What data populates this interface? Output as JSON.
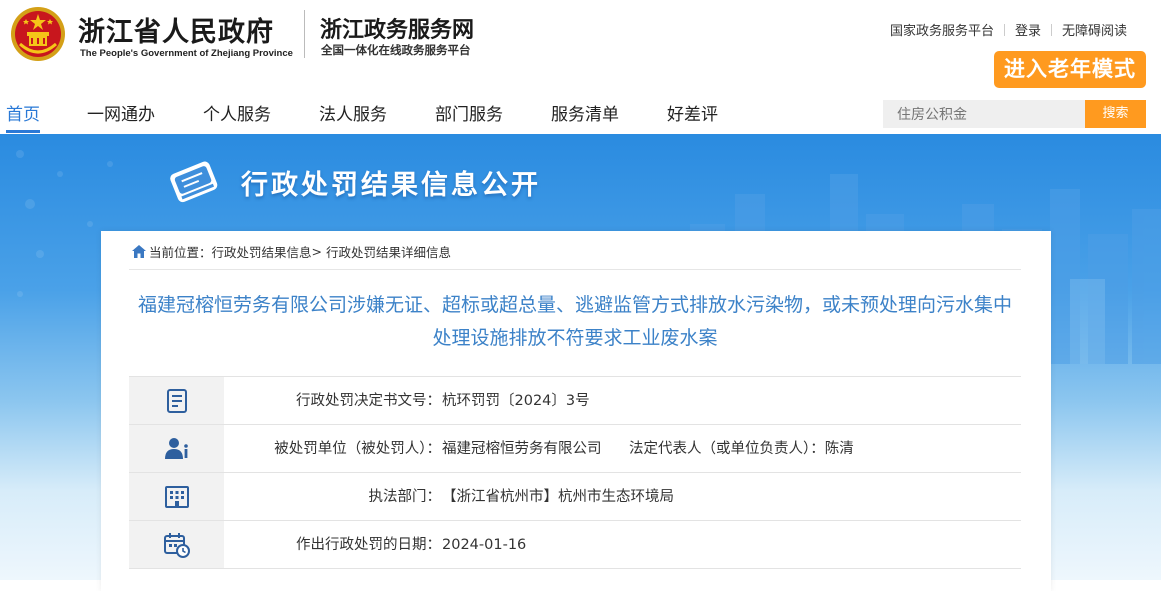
{
  "header": {
    "gov_title": "浙江省人民政府",
    "gov_title_en": "The People's Government of Zhejiang Province",
    "site_title": "浙江政务服务网",
    "site_subtitle": "全国一体化在线政务服务平台",
    "top_links": [
      "国家政务服务平台",
      "登录",
      "无障碍阅读"
    ],
    "elder_mode_button": "进入老年模式"
  },
  "nav": {
    "items": [
      "首页",
      "一网通办",
      "个人服务",
      "法人服务",
      "部门服务",
      "服务清单",
      "好差评"
    ],
    "active": "首页"
  },
  "search": {
    "placeholder": "住房公积金",
    "button": "搜索"
  },
  "banner": {
    "title": "行政处罚结果信息公开"
  },
  "breadcrumb": {
    "prefix": "当前位置：",
    "level1": "行政处罚结果信息",
    "separator": ">",
    "level2": "行政处罚结果详细信息"
  },
  "case": {
    "title": "福建冠榕恒劳务有限公司涉嫌无证、超标或超总量、逃避监管方式排放水污染物，或未预处理向污水集中处理设施排放不符要求工业废水案",
    "rows": [
      {
        "icon": "document-icon",
        "label": "行政处罚决定书文号：",
        "value": "杭环罚罚〔2024〕3号"
      },
      {
        "icon": "person-icon",
        "label": "被处罚单位（被处罚人）：",
        "value": "福建冠榕恒劳务有限公司",
        "label2": "法定代表人（或单位负责人）：",
        "value2": "陈清"
      },
      {
        "icon": "building-icon",
        "label": "执法部门：",
        "value": "【浙江省杭州市】杭州市生态环境局"
      },
      {
        "icon": "calendar-icon",
        "label": "作出行政处罚的日期：",
        "value": "2024-01-16"
      }
    ]
  },
  "colors": {
    "accent_blue": "#2a79d6",
    "title_blue": "#3c82c8",
    "orange": "#ff9a1f"
  }
}
